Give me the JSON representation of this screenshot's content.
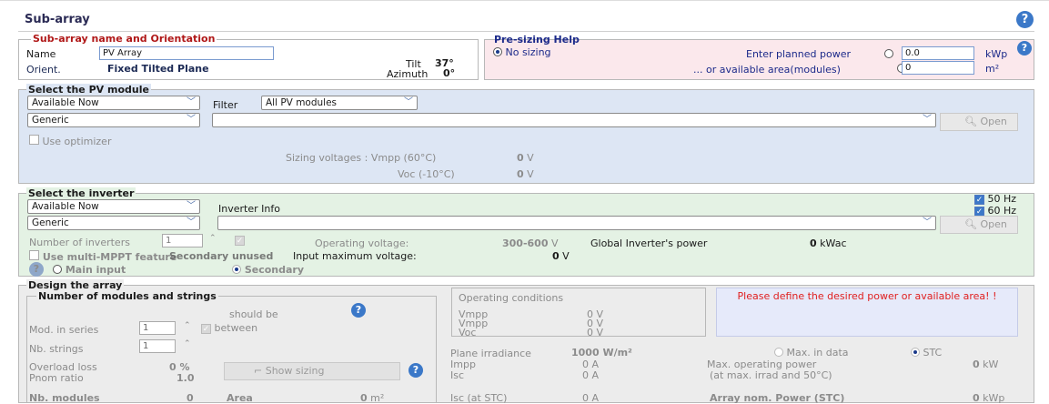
{
  "header": {
    "title": "Sub-array"
  },
  "orientation": {
    "legend": "Sub-array name and Orientation",
    "name_label": "Name",
    "name_value": "PV Array",
    "orient_label": "Orient.",
    "orient_value": "Fixed Tilted Plane",
    "tilt_label": "Tilt",
    "tilt_value": "37°",
    "azimuth_label": "Azimuth",
    "azimuth_value": "0°"
  },
  "presizing": {
    "legend": "Pre-sizing Help",
    "no_sizing": "No sizing",
    "power_label": "Enter planned power",
    "power_value": "0.0",
    "power_unit": "kWp",
    "area_label": "... or available area(modules)",
    "area_value": "0",
    "area_unit": "m²"
  },
  "pv_module": {
    "legend": "Select the PV module",
    "availability": "Available Now",
    "filter_label": "Filter",
    "filter_value": "All PV modules",
    "manufacturer": "Generic",
    "model": "",
    "open_label": "Open",
    "optimizer_label": "Use optimizer",
    "sizing_label": "Sizing voltages : Vmpp (60°C)",
    "vmpp_value": "0",
    "volt_unit": "V",
    "voc_label": "Voc  (-10°C)",
    "voc_value": "0"
  },
  "inverter": {
    "legend": "Select the inverter",
    "availability": "Available Now",
    "info_label": "Inverter Info",
    "hz50": "50 Hz",
    "hz60": "60 Hz",
    "manufacturer": "Generic",
    "model": "",
    "open_label": "Open",
    "num_label": "Number of inverters",
    "num_value": "1",
    "op_voltage_label": "Operating voltage:",
    "op_voltage_value": "300-600",
    "volt_unit": "V",
    "global_power_label": "Global Inverter's power",
    "global_power_value": "0",
    "global_power_unit": "kWac",
    "mppt_label": "Use multi-MPPT feature",
    "secondary_unused": "Secondary unused",
    "input_max_label": "Input maximum voltage:",
    "input_max_value": "0",
    "main_input": "Main input",
    "secondary": "Secondary"
  },
  "design": {
    "legend": "Design the array",
    "sub_legend": "Number of modules and strings",
    "should_be": "should be",
    "mod_series_label": "Mod. in series",
    "mod_series_value": "1",
    "between_label": "between",
    "nb_strings_label": "Nb. strings",
    "nb_strings_value": "1",
    "overload_label": "Overload loss",
    "overload_value": "0 %",
    "pnom_label": "Pnom ratio",
    "pnom_value": "1.0",
    "show_sizing": "Show sizing",
    "nb_modules_label": "Nb. modules",
    "nb_modules_value": "0",
    "area_label": "Area",
    "area_value": "0",
    "area_unit": "m²",
    "opcond_legend": "Operating conditions",
    "vmpp1_label": "Vmpp",
    "vmpp2_label": "Vmpp",
    "voc_label": "Voc",
    "v_zero": "0",
    "v_unit": "V",
    "warning": "Please define the desired power or available area! !",
    "irr_label": "Plane irradiance",
    "irr_value": "1000 W/m²",
    "max_in_data": "Max. in data",
    "stc": "STC",
    "impp_label": "Impp",
    "impp_value": "0 A",
    "isc_label": "Isc",
    "isc_value": "0 A",
    "maxop_label": "Max. operating power",
    "maxop_sub": "(at max. irrad and 50°C)",
    "maxop_value": "0",
    "maxop_unit": "kW",
    "isc_stc_label": "Isc (at STC)",
    "isc_stc_value": "0 A",
    "nom_power_label": "Array nom. Power (STC)",
    "nom_power_value": "0",
    "nom_power_unit": "kWp"
  }
}
